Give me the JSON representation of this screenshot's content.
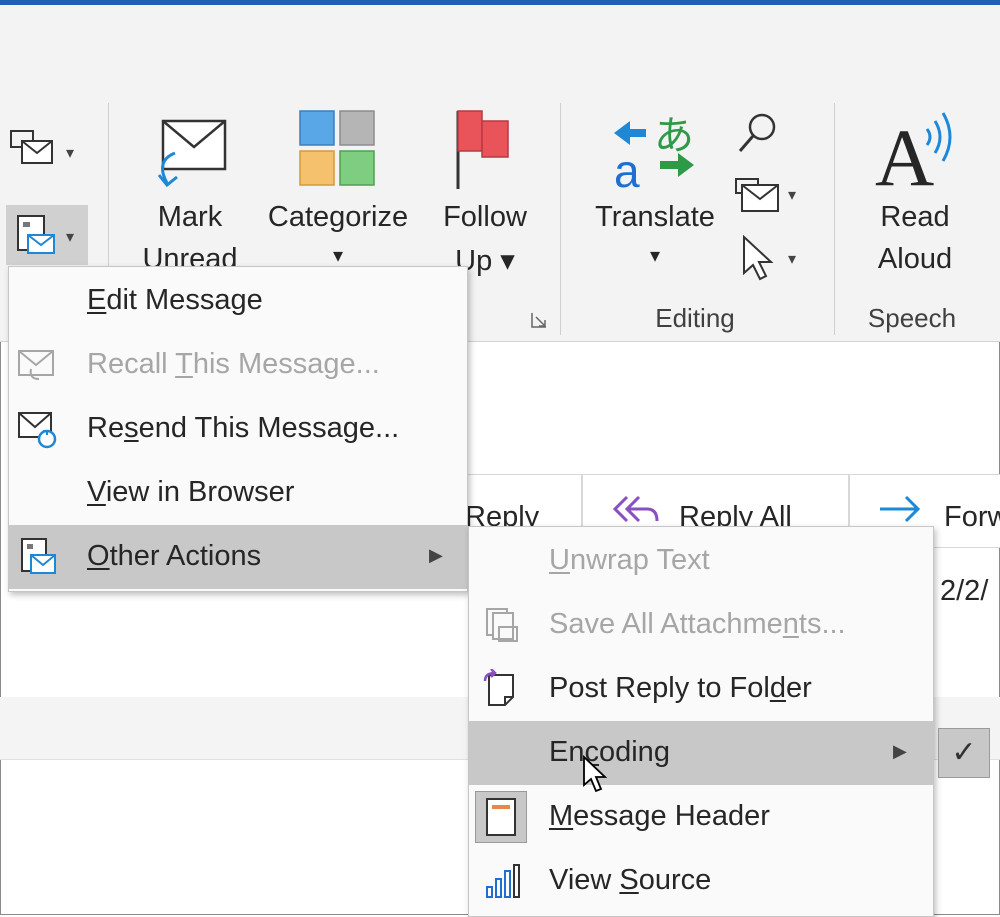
{
  "ribbon": {
    "buttons": {
      "mark_unread": [
        "Mark",
        "Unread"
      ],
      "categorize": [
        "Categorize",
        "▾"
      ],
      "follow_up": [
        "Follow",
        "Up ▾"
      ],
      "translate": [
        "Translate",
        "▾"
      ],
      "read_aloud": [
        "Read",
        "Aloud"
      ]
    },
    "groups": {
      "editing": "Editing",
      "speech": "Speech"
    }
  },
  "message": {
    "reply": "Reply",
    "reply_all": "Reply All",
    "forward": "Forw",
    "date": "2/2/"
  },
  "menu": {
    "items": [
      {
        "pre": "",
        "u": "E",
        "post": "dit Message",
        "disabled": false
      },
      {
        "pre": "Recall ",
        "u": "T",
        "post": "his Message...",
        "disabled": true
      },
      {
        "pre": "Re",
        "u": "s",
        "post": "end This Message...",
        "disabled": false
      },
      {
        "pre": "",
        "u": "V",
        "post": "iew in Browser",
        "disabled": false
      },
      {
        "pre": "",
        "u": "O",
        "post": "ther Actions",
        "disabled": false
      }
    ]
  },
  "submenu": {
    "items": [
      {
        "pre": "",
        "u": "U",
        "post": "nwrap Text",
        "disabled": true
      },
      {
        "pre": "Save All Attachme",
        "u": "n",
        "post": "ts...",
        "disabled": true
      },
      {
        "pre": "Post Reply to Fol",
        "u": "d",
        "post": "er",
        "disabled": false
      },
      {
        "pre": "En",
        "u": "c",
        "post": "oding",
        "disabled": false
      },
      {
        "pre": "",
        "u": "M",
        "post": "essage Header",
        "disabled": false
      },
      {
        "pre": "View ",
        "u": "S",
        "post": "ource",
        "disabled": false
      }
    ]
  },
  "encoding_check": "✓",
  "colors": {
    "accent_blue": "#1f5fb3",
    "flag_red": "#e8545a",
    "highlight": "#c8c8c8"
  }
}
